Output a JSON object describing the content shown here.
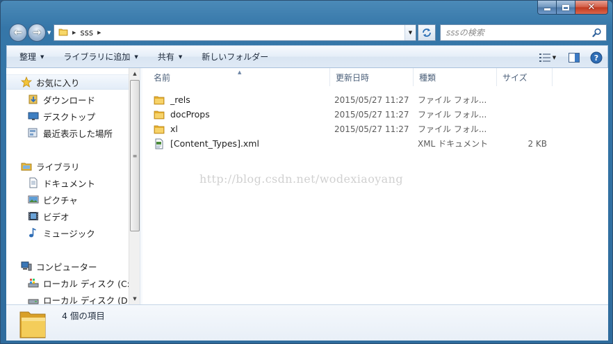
{
  "window": {
    "controls": {
      "minimize": "minimize",
      "maximize": "maximize",
      "close": "✕"
    }
  },
  "address": {
    "segments": [
      "sss"
    ],
    "search_placeholder": "sssの検索"
  },
  "toolbar": {
    "organize": "整理",
    "add_to_library": "ライブラリに追加",
    "share": "共有",
    "new_folder": "新しいフォルダー"
  },
  "nav": {
    "favorites": {
      "label": "お気に入り",
      "items": [
        "ダウンロード",
        "デスクトップ",
        "最近表示した場所"
      ]
    },
    "libraries": {
      "label": "ライブラリ",
      "items": [
        "ドキュメント",
        "ピクチャ",
        "ビデオ",
        "ミュージック"
      ]
    },
    "computer": {
      "label": "コンピューター",
      "items": [
        "ローカル ディスク (C:",
        "ローカル ディスク (D:"
      ]
    }
  },
  "columns": {
    "name": "名前",
    "date": "更新日時",
    "type": "種類",
    "size": "サイズ"
  },
  "files": [
    {
      "name": "_rels",
      "date": "2015/05/27 11:27",
      "type": "ファイル フォル...",
      "size": "",
      "icon": "folder-icon"
    },
    {
      "name": "docProps",
      "date": "2015/05/27 11:27",
      "type": "ファイル フォル...",
      "size": "",
      "icon": "folder-icon"
    },
    {
      "name": "xl",
      "date": "2015/05/27 11:27",
      "type": "ファイル フォル...",
      "size": "",
      "icon": "folder-icon"
    },
    {
      "name": "[Content_Types].xml",
      "date": "",
      "type": "XML ドキュメント",
      "size": "2 KB",
      "icon": "xml-file-icon"
    }
  ],
  "watermark": "http://blog.csdn.net/wodexiaoyang",
  "status": {
    "item_count": "4 個の項目"
  },
  "colors": {
    "frame": "#3576a8",
    "folder": "#f2c94c",
    "accent": "#1e5a9e"
  }
}
